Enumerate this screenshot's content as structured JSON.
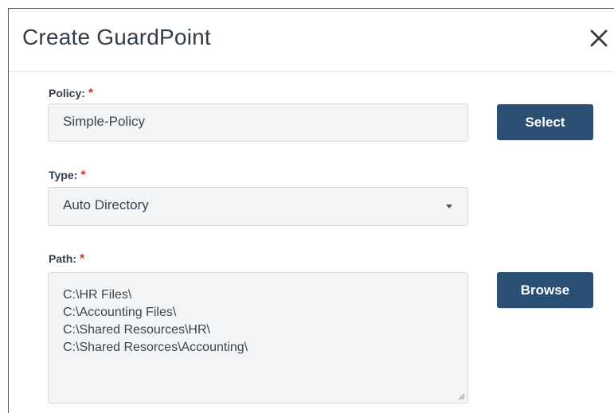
{
  "dialog": {
    "title": "Create GuardPoint",
    "close_icon": "close-icon"
  },
  "policy": {
    "label": "Policy:",
    "required_mark": "*",
    "value": "Simple-Policy",
    "select_button": "Select"
  },
  "type": {
    "label": "Type:",
    "required_mark": "*",
    "value": "Auto Directory",
    "dropdown_icon": "caret-down-icon"
  },
  "path": {
    "label": "Path:",
    "required_mark": "*",
    "lines": [
      "C:\\HR Files\\",
      "C:\\Accounting Files\\",
      "C:\\Shared Resources\\HR\\",
      "C:\\Shared Resorces\\Accounting\\"
    ],
    "browse_button": "Browse"
  },
  "colors": {
    "button_bg": "#2b4f73",
    "required": "#d9342b",
    "field_bg": "#f3f4f5"
  }
}
